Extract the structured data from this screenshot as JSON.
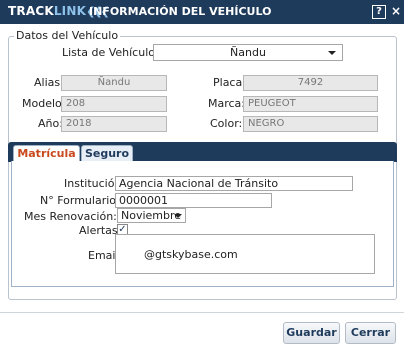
{
  "window": {
    "logo_track": "TRACK",
    "logo_link": "LINK",
    "logo_chevrons": "❮❮❮",
    "title": "INFORMACIÓN DEL VEHÍCULO",
    "help_label": "?",
    "close_label": "×"
  },
  "vehicle_data": {
    "legend": "Datos del Vehículo",
    "list_label": "Lista de Vehículos:",
    "list_value": "Ñandu",
    "alias_label": "Alias:",
    "alias_value": "Ñandu",
    "placa_label": "Placa:",
    "placa_value": "7492",
    "modelo_label": "Modelo:",
    "modelo_value": "208",
    "marca_label": "Marca:",
    "marca_value": "PEUGEOT",
    "anio_label": "Año:",
    "anio_value": "2018",
    "color_label": "Color:",
    "color_value": "NEGRO"
  },
  "tabs": [
    {
      "label": "Matrícula",
      "active": true
    },
    {
      "label": "Seguro",
      "active": false
    }
  ],
  "matricula": {
    "institucion_label": "Institución:",
    "institucion_value": "Agencia Nacional de Tránsito",
    "formulario_label": "N° Formulario:",
    "formulario_value": "0000001",
    "renovacion_label": "Mes Renovación:",
    "renovacion_value": "Noviembre",
    "alertas_label": "Alertas:",
    "alertas_checked": true,
    "alertas_mark": "✓",
    "email_label": "Email:",
    "email_value": "@gtskybase.com"
  },
  "footer": {
    "save_label": "Guardar",
    "close_label": "Cerrar"
  },
  "colors": {
    "header_bg": "#1f3b5c",
    "active_tab_text": "#c8491d",
    "logo_accent": "#8fc2ea"
  }
}
